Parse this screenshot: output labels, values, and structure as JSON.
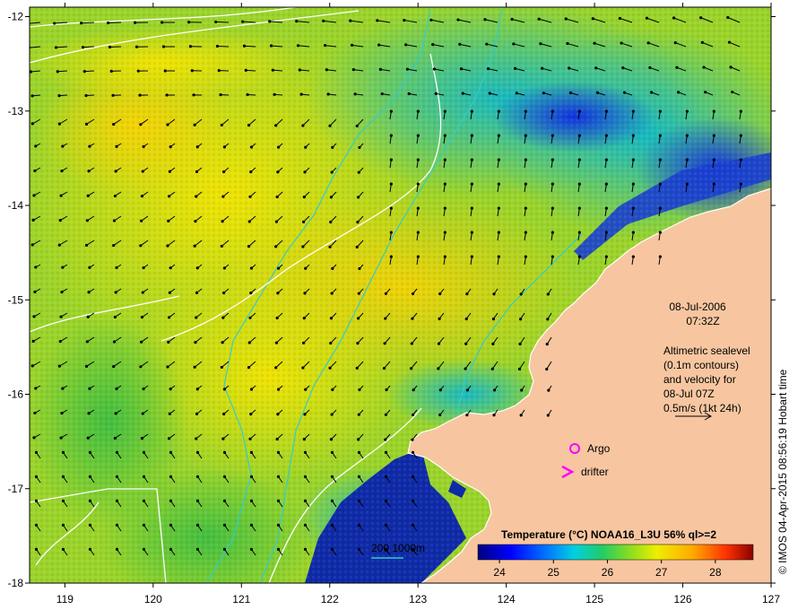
{
  "map": {
    "x_ticks": [
      "119",
      "120",
      "121",
      "122",
      "123",
      "124",
      "125",
      "126",
      "127"
    ],
    "y_ticks": [
      "-12",
      "-13",
      "-14",
      "-15",
      "-16",
      "-17",
      "-18"
    ],
    "lon_range": [
      118.6,
      127.0
    ],
    "lat_range": [
      -18.0,
      -11.9
    ]
  },
  "annotations": {
    "date": "08-Jul-2006",
    "time": "07:32Z",
    "altimetry_lines": [
      "Altimetric sealevel",
      "(0.1m contours)",
      "and velocity for",
      "08-Jul 07Z",
      "0.5m/s (1kt 24h)"
    ],
    "argo_label": "Argo",
    "drifter_label": "drifter",
    "depth_contours_label": "200  1000m",
    "credit": "© IMOS 04-Apr-2015 08:56:19 Hobart time"
  },
  "colorbar": {
    "title": "Temperature (°C) NOAA16_L3U 56% ql>=2",
    "ticks": [
      "24",
      "25",
      "26",
      "27",
      "28"
    ],
    "range": [
      23.6,
      28.7
    ]
  },
  "colors": {
    "land": "#f7c6a0",
    "argo": "#ff00ff",
    "drifter": "#ff00ff",
    "depth_contour": "#33cccc"
  }
}
